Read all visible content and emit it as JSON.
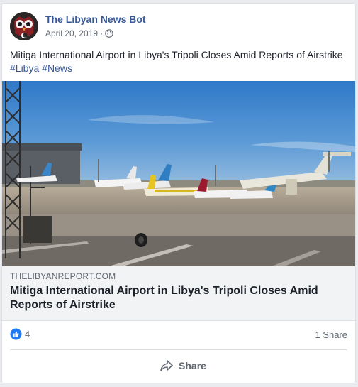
{
  "post": {
    "author": "The Libyan News Bot",
    "date": "April 20, 2019",
    "separator": "·",
    "privacy_icon": "globe-icon",
    "message": "Mitiga International Airport in Libya's Tripoli Closes Amid Reports of Airstrike",
    "hashtags": [
      "#Libya",
      "#News"
    ]
  },
  "link_preview": {
    "domain": "THELIBYANREPORT.COM",
    "title": "Mitiga International Airport in Libya's Tripoli Closes Amid Reports of Airstrike",
    "image": "airport-photo"
  },
  "engagement": {
    "reaction_icon": "like-icon",
    "reaction_count": "4",
    "share_count": "1 Share"
  },
  "actions": {
    "share_label": "Share",
    "share_icon": "share-arrow-icon"
  },
  "colors": {
    "link_blue": "#385898",
    "meta_gray": "#606770",
    "preview_bg": "#f2f3f5",
    "like_blue": "#2078f4"
  }
}
